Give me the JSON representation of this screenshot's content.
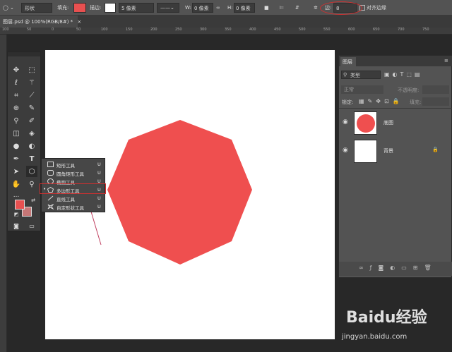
{
  "options_bar": {
    "mode": "形状",
    "fill_label": "填充:",
    "fill_color": "#e85050",
    "stroke_label": "描边:",
    "stroke_width": "5 像素",
    "w_label": "W:",
    "w_value": "0 像素",
    "h_label": "H:",
    "h_value": "0 像素",
    "edges_label": "边:",
    "edges_value": "8",
    "align_edges_label": "对齐边缘"
  },
  "document_tab": {
    "title": "图层.psd @ 100%(RGB/8#) *",
    "close": "×"
  },
  "ruler": {
    "ticks": [
      "100",
      "50",
      "0",
      "50",
      "100",
      "150",
      "200",
      "250",
      "300",
      "350",
      "400",
      "450",
      "500",
      "550",
      "600",
      "650",
      "700",
      "750"
    ]
  },
  "canvas": {
    "polygon_color": "#ef4f4f",
    "sides": 8
  },
  "toolbox": {
    "foreground_color": "#e85050",
    "background_color": "#c77777",
    "more": "..."
  },
  "flyout": {
    "items": [
      {
        "label": "矩形工具",
        "shortcut": "U",
        "icon": "rectangle-icon",
        "selected": false
      },
      {
        "label": "圆角矩形工具",
        "shortcut": "U",
        "icon": "rounded-rectangle-icon",
        "selected": false
      },
      {
        "label": "椭圆工具",
        "shortcut": "U",
        "icon": "ellipse-icon",
        "selected": false
      },
      {
        "label": "多边形工具",
        "shortcut": "U",
        "icon": "polygon-icon",
        "selected": true
      },
      {
        "label": "直线工具",
        "shortcut": "U",
        "icon": "line-icon",
        "selected": false
      },
      {
        "label": "自定形状工具",
        "shortcut": "U",
        "icon": "custom-shape-icon",
        "selected": false
      }
    ]
  },
  "layers_panel": {
    "tab": "图层",
    "filter_kind": "类型",
    "blend_mode": "正常",
    "opacity_label": "不透明度:",
    "lock_label": "锁定:",
    "fill_label": "填充:",
    "layers": [
      {
        "name": "底图",
        "thumb": "red-circle"
      },
      {
        "name": "背景",
        "thumb": "white",
        "locked": true
      }
    ],
    "bottom_icons": [
      "link-icon",
      "fx-icon",
      "mask-icon",
      "adjustment-icon",
      "folder-icon",
      "new-layer-icon",
      "trash-icon"
    ]
  },
  "watermark": {
    "brand": "Baidu经验",
    "url": "jingyan.baidu.com"
  }
}
